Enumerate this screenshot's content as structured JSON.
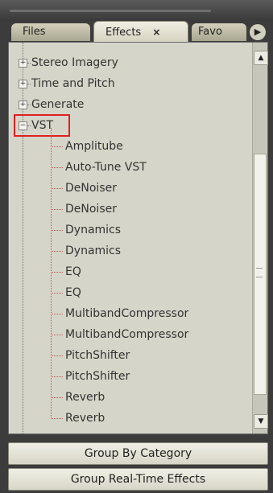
{
  "tabs": {
    "files": "Files",
    "effects": "Effects",
    "effects_close": "×",
    "favo": "Favo",
    "more_arrow": "▶"
  },
  "tree": {
    "groups": [
      {
        "label": "Stereo Imagery",
        "expanded": false
      },
      {
        "label": "Time and Pitch",
        "expanded": false
      },
      {
        "label": "Generate",
        "expanded": false
      },
      {
        "label": "VST",
        "expanded": true
      }
    ],
    "vst_children": [
      "Amplitube",
      "Auto-Tune VST",
      "DeNoiser",
      "DeNoiser",
      "Dynamics",
      "Dynamics",
      "EQ",
      "EQ",
      "MultibandCompressor",
      "MultibandCompressor",
      "PitchShifter",
      "PitchShifter",
      "Reverb",
      "Reverb"
    ],
    "collapsed_sign": "+",
    "expanded_sign": "−"
  },
  "scrollbar": {
    "up": "▲",
    "down": "▼"
  },
  "buttons": {
    "group_by_category": "Group By Category",
    "group_realtime": "Group Real-Time Effects"
  },
  "colors": {
    "highlight": "#e02020"
  }
}
